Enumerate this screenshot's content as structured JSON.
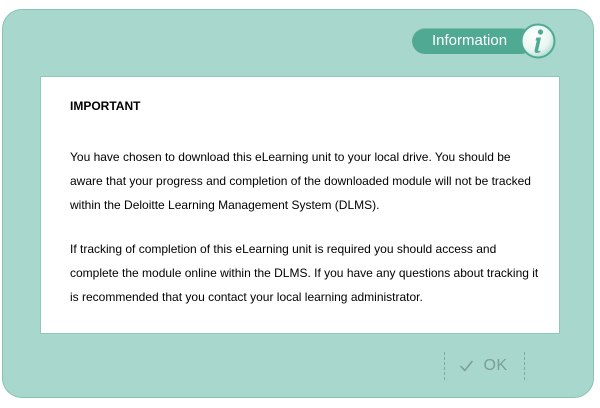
{
  "dialog": {
    "badge": {
      "label": "Information",
      "icon": "info-icon"
    },
    "content": {
      "heading": "IMPORTANT",
      "paragraphs": [
        "You have chosen to download this eLearning unit to your local drive. You should be aware that your progress and completion of the downloaded module will not be tracked within the Deloitte Learning Management System (DLMS).",
        "If tracking of completion of this eLearning unit is required you should access and complete the module online within the DLMS. If you have any questions about tracking it is recommended that you contact your local learning administrator."
      ]
    },
    "ok_button": {
      "label": "OK",
      "icon": "checkmark-icon"
    }
  },
  "colors": {
    "dialog_background": "#a8d8cd",
    "badge_background": "#4fa993",
    "ok_text": "#7f9c95"
  }
}
